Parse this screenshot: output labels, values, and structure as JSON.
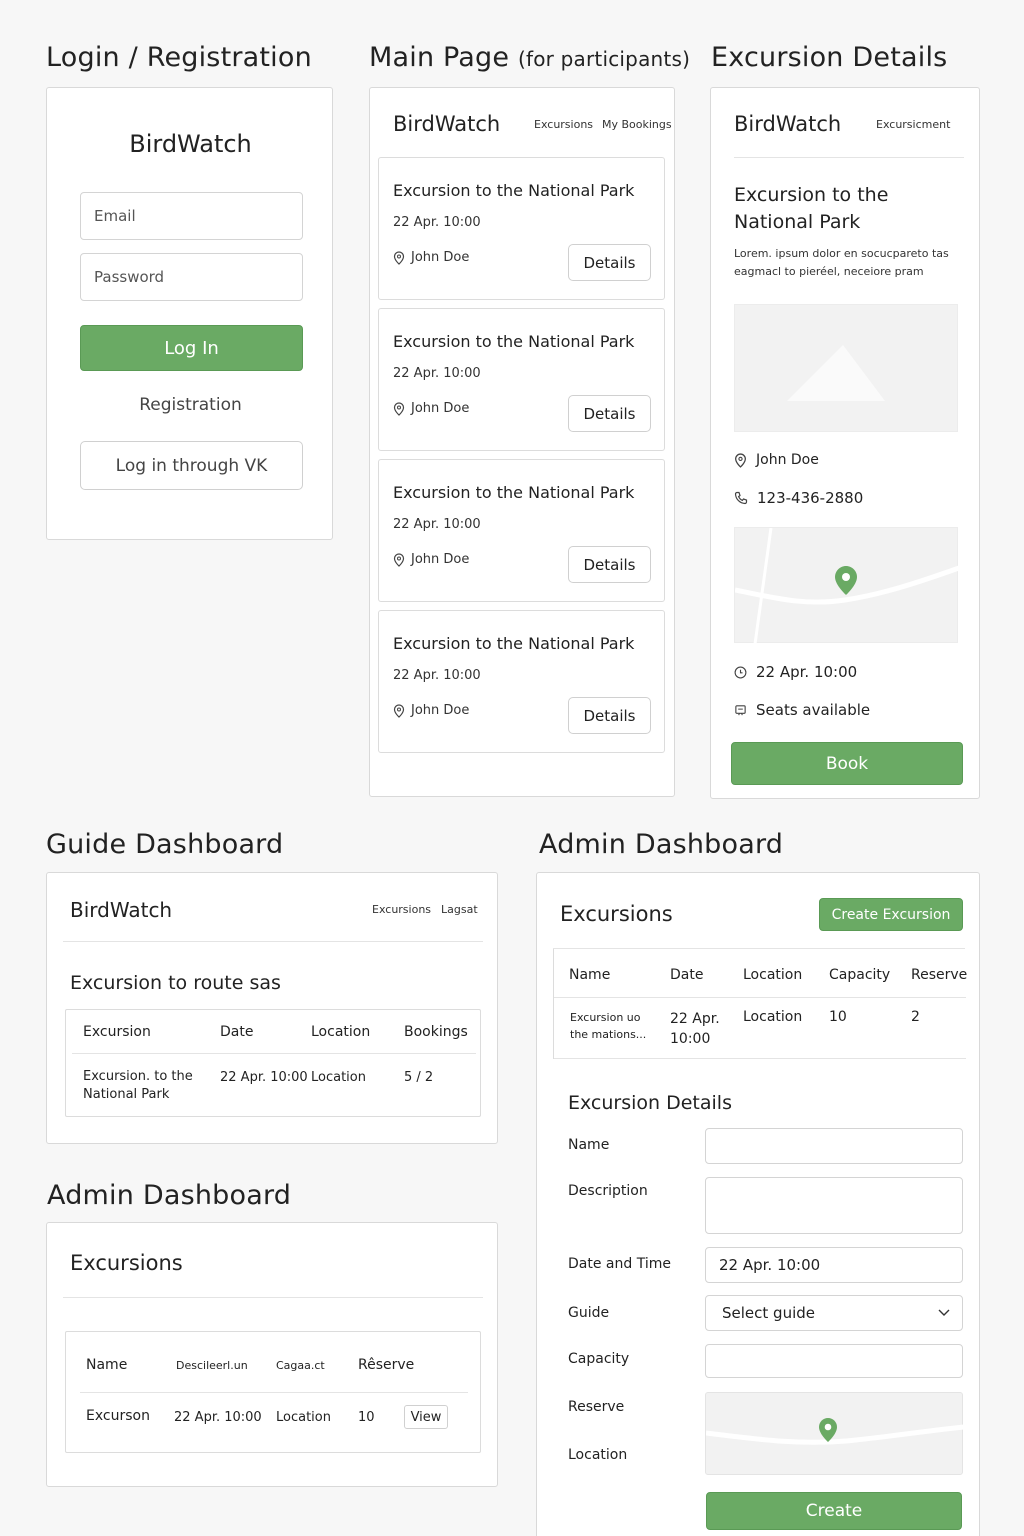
{
  "titles": {
    "login": "Login / Registration",
    "main": "Main Page",
    "main_sub": "(for participants)",
    "details": "Excursion Details",
    "guide": "Guide Dashboard",
    "admin_right": "Admin Dashboard",
    "admin_left": "Admin Dashboard"
  },
  "login": {
    "brand": "BirdWatch",
    "email_placeholder": "Email",
    "password_placeholder": "Password",
    "login_button": "Log In",
    "registration_link": "Registration",
    "vk_button": "Log in through VK"
  },
  "main": {
    "brand": "BirdWatch",
    "nav": [
      "Excursions",
      "My Bookings"
    ],
    "cards": [
      {
        "title": "Excursion to the National Park",
        "date": "22 Apr. 10:00",
        "guide": "John Doe",
        "button": "Details"
      },
      {
        "title": "Excursion to the National Park",
        "date": "22 Apr. 10:00",
        "guide": "John Doe",
        "button": "Details"
      },
      {
        "title": "Excursion to the National Park",
        "date": "22 Apr. 10:00",
        "guide": "John Doe",
        "button": "Details"
      },
      {
        "title": "Excursion to the National Park",
        "date": "22 Apr. 10:00",
        "guide": "John Doe",
        "button": "Details"
      }
    ]
  },
  "details": {
    "brand": "BirdWatch",
    "nav": "Excursicment",
    "title_line1": "Excursion to the",
    "title_line2": "National Park",
    "desc_line1": "Lorem. ipsum dolor en socucpareto tas",
    "desc_line2": "eagmacl to pieréel, neceiore pram",
    "guide": "John Doe",
    "phone": "123-436-2880",
    "datetime": "22 Apr. 10:00",
    "seats": "Seats available",
    "book_button": "Book",
    "accent": "#6aaa64"
  },
  "guide": {
    "brand": "BirdWatch",
    "nav": [
      "Excursions",
      "Lagsat"
    ],
    "heading": "Excursion to route sas",
    "headers": [
      "Excursion",
      "Date",
      "Location",
      "Bookings"
    ],
    "row": {
      "excursion_line1": "Excursion. to the",
      "excursion_line2": "National Park",
      "date": "22 Apr. 10:00",
      "location": "Location",
      "bookings": "5 / 2"
    }
  },
  "admin_left": {
    "heading": "Excursions",
    "headers": [
      "Name",
      "Descileerl.un",
      "Cagaa.ct",
      "Rêserve"
    ],
    "row": {
      "name": "Excurson",
      "date": "22 Apr. 10:00",
      "location": "Location",
      "capacity": "10",
      "action": "View"
    }
  },
  "admin_right": {
    "heading": "Excursions",
    "create_button": "Create Excursion",
    "headers": [
      "Name",
      "Date",
      "Location",
      "Capacity",
      "Reserve"
    ],
    "row": {
      "name_line1": "Excursion uo",
      "name_line2": "the mations...",
      "date_line1": "22 Apr.",
      "date_line2": "10:00",
      "location": "Location",
      "capacity": "10",
      "reserve": "2"
    },
    "form_title": "Excursion Details",
    "labels": {
      "name": "Name",
      "description": "Description",
      "datetime": "Date and Time",
      "guide": "Guide",
      "capacity": "Capacity",
      "reserve": "Reserve",
      "location": "Location"
    },
    "datetime_value": "22 Apr. 10:00",
    "guide_placeholder": "Select guide",
    "create_submit": "Create"
  }
}
